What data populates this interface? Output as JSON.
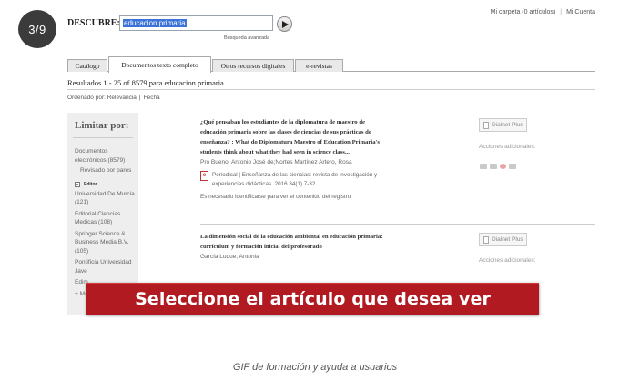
{
  "step_counter": "3/9",
  "header": {
    "links": [
      "Mi carpeta (0 artículos)",
      "Mi Cuenta"
    ],
    "search_label": "DESCUBRE:",
    "search_value": "educacion primaria",
    "advanced_search": "Búsqueda avanzada"
  },
  "tabs": [
    {
      "label": "Catálogo"
    },
    {
      "label": "Documentos texto completo",
      "active": true
    },
    {
      "label": "Otros recursos digitales"
    },
    {
      "label": "e-revistas"
    }
  ],
  "results_summary": "Resultados 1 - 25 of 8579 para educacion primaria",
  "sort": {
    "label": "Ordenado por:",
    "option_relevance": "Relevancia",
    "option_date": "Fecha"
  },
  "sidebar": {
    "heading": "Limitar por:",
    "doc_type": "Documentos electrónicos (8579)",
    "peer_reviewed": "Revisado por pares",
    "editor_label": "Editor",
    "publishers": [
      "Universidad De Murcia (121)",
      "Editorial Ciencias Medicas (108)",
      "Springer Science & Business Media B.V. (105)",
      "Pontificia Universidad",
      "Jave",
      "Edim",
      "+ Má"
    ]
  },
  "results": [
    {
      "title": "¿Qué pensaban los estudiantes de la diplomatura de maestro de educación primaria sobre las clases de ciencias de sus prácticas de enseñanza? : What do Diplomatura Maestro of Education Primaria's students think about what they had seen in science class...",
      "authors": "Pro Bueno, Antonio José de;Nortes Martínez Artero, Rosa",
      "type": "Periodical",
      "source": "Enseñanza de las ciencias: revista de investigación y experiencias didácticas. 2016 34(1) 7-32",
      "note": "Es necesario identificarse para ver el contenido del registro",
      "dialnet": "Dialnet Plus",
      "actions": "Acciones adicionales:"
    },
    {
      "title": "La dimensión social de la educación ambiental en educación primaria: currículum y formación inicial del profesorado",
      "authors": "García Luque, Antonia",
      "dialnet": "Dialnet Plus",
      "actions": "Acciones adicionales:"
    }
  ],
  "banner_text": "Seleccione el artículo que desea ver",
  "caption": "GIF de formación y ayuda a usuarios",
  "colors": {
    "banner": "#b11a20",
    "badge": "#3b3b3b",
    "selection": "#3b73d8"
  }
}
